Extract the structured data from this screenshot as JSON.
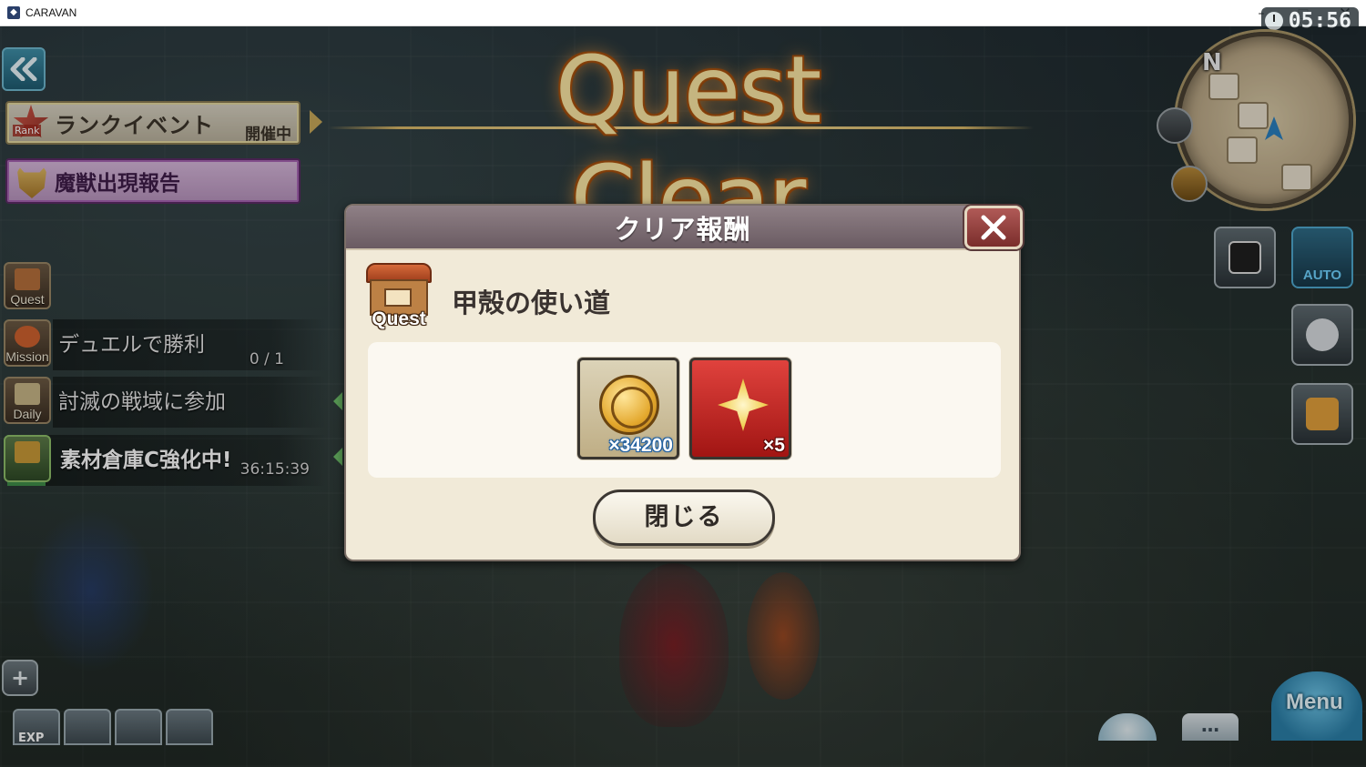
{
  "window": {
    "title": "CARAVAN",
    "minimize": "–",
    "maximize": "□",
    "close": "✕"
  },
  "hud": {
    "clock": "05:56",
    "north": "N",
    "auto_label": "AUTO",
    "menu_label": "Menu",
    "chat_label": "…",
    "exp_label": "EXP"
  },
  "events": {
    "rank": {
      "tag": "Rank",
      "label": "ランクイベント",
      "status": "開催中"
    },
    "monster": {
      "label": "魔獣出現報告"
    }
  },
  "side_menu": {
    "quest_label": "Quest",
    "mission": {
      "icon_label": "Mission",
      "title": "デュエルで勝利",
      "progress": "0 / 1"
    },
    "daily": {
      "icon_label": "Daily",
      "title": "討滅の戦域に参加"
    },
    "storage": {
      "title": "素材倉庫C強化中!",
      "time": "36:15:39"
    }
  },
  "banner": {
    "title": "Quest Clear"
  },
  "dialog": {
    "title": "クリア報酬",
    "quest_badge": "Quest",
    "quest_name": "甲殻の使い道",
    "rewards": [
      {
        "icon": "gold-coin-icon",
        "quantity": "×34200"
      },
      {
        "icon": "star-crystal-icon",
        "quantity": "×5"
      }
    ],
    "close_button": "閉じる"
  },
  "colors": {
    "dialog_bg": "#f1ead8",
    "dialog_header": "#7a6b72",
    "title_gold": "#fde8a4",
    "close_x_red": "#9a4441",
    "reward_red": "#c82b27",
    "qty_blue": "#1f5fa0"
  }
}
